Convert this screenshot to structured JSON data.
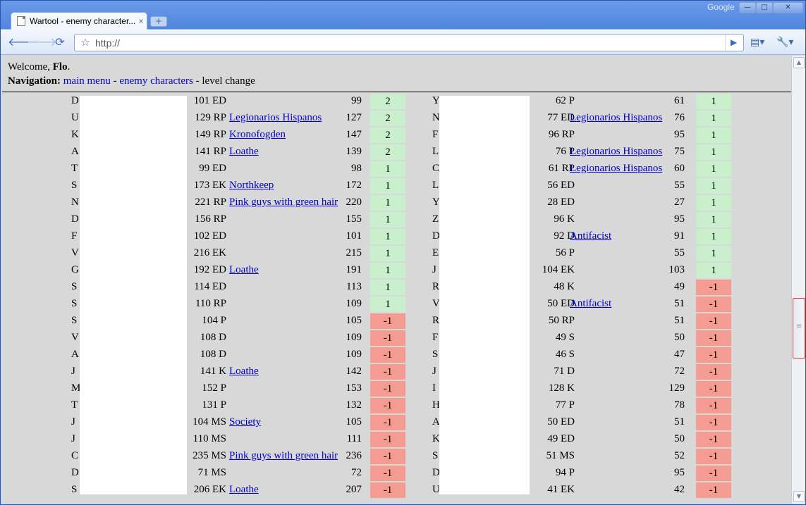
{
  "browser": {
    "tab_title": "Wartool - enemy character...",
    "tab_close": "×",
    "new_tab": "+",
    "brand": "Google",
    "address": "http://",
    "win_min": "—",
    "win_max": "□",
    "win_close": "✕"
  },
  "icons": {
    "back": "back-arrow-icon",
    "forward": "forward-arrow-icon",
    "reload": "reload-icon",
    "star": "star-icon",
    "go": "go-arrow-icon",
    "page": "page-menu-icon",
    "tools": "wrench-icon"
  },
  "header": {
    "welcome_prefix": "Welcome, ",
    "user": "Flo",
    "welcome_suffix": ".",
    "nav_label": "Navigation",
    "nav_colon": ":",
    "link_main": "main menu",
    "sep1": " - ",
    "link_enemy": "enemy characters",
    "sep2": " - ",
    "current": "level change"
  },
  "colors": {
    "positive": "#c9efcd",
    "negative": "#f49c92",
    "link": "#0000cc",
    "background": "#d8d8d8"
  },
  "left_rows": [
    {
      "name": "D",
      "lvl": "101 ED",
      "guild": "",
      "new": "99",
      "change": "2"
    },
    {
      "name": "U",
      "lvl": "129 RP",
      "guild": "Legionarios Hispanos",
      "new": "127",
      "change": "2"
    },
    {
      "name": "K",
      "lvl": "149 RP",
      "guild": "Kronofogden",
      "new": "147",
      "change": "2"
    },
    {
      "name": "A",
      "lvl": "141 RP",
      "guild": "Loathe",
      "new": "139",
      "change": "2"
    },
    {
      "name": "T",
      "lvl": "99 ED",
      "guild": "",
      "new": "98",
      "change": "1"
    },
    {
      "name": "S",
      "lvl": "173 EK",
      "guild": "Northkeep",
      "new": "172",
      "change": "1"
    },
    {
      "name": "N",
      "lvl": "221 RP",
      "guild": "Pink guys with green hair",
      "new": "220",
      "change": "1"
    },
    {
      "name": "D",
      "lvl": "156 RP",
      "guild": "",
      "new": "155",
      "change": "1"
    },
    {
      "name": "F",
      "lvl": "102 ED",
      "guild": "",
      "new": "101",
      "change": "1"
    },
    {
      "name": "V",
      "lvl": "216 EK",
      "guild": "",
      "new": "215",
      "change": "1"
    },
    {
      "name": "G",
      "lvl": "192 ED",
      "guild": "Loathe",
      "new": "191",
      "change": "1"
    },
    {
      "name": "S",
      "lvl": "114 ED",
      "guild": "",
      "new": "113",
      "change": "1"
    },
    {
      "name": "S",
      "lvl": "110 RP",
      "guild": "",
      "new": "109",
      "change": "1"
    },
    {
      "name": "S",
      "lvl": "104 P",
      "guild": "",
      "new": "105",
      "change": "-1"
    },
    {
      "name": "V",
      "lvl": "108 D",
      "guild": "",
      "new": "109",
      "change": "-1"
    },
    {
      "name": "A",
      "lvl": "108 D",
      "guild": "",
      "new": "109",
      "change": "-1"
    },
    {
      "name": "J",
      "lvl": "141 K",
      "guild": "Loathe",
      "new": "142",
      "change": "-1"
    },
    {
      "name": "M",
      "lvl": "152 P",
      "guild": "",
      "new": "153",
      "change": "-1"
    },
    {
      "name": "T",
      "lvl": "131 P",
      "guild": "",
      "new": "132",
      "change": "-1"
    },
    {
      "name": "J",
      "lvl": "104 MS",
      "guild": "Society",
      "new": "105",
      "change": "-1"
    },
    {
      "name": "J",
      "lvl": "110 MS",
      "guild": "",
      "new": "111",
      "change": "-1"
    },
    {
      "name": "C",
      "lvl": "235 MS",
      "guild": "Pink guys with green hair",
      "new": "236",
      "change": "-1"
    },
    {
      "name": "D",
      "lvl": "71 MS",
      "guild": "",
      "new": "72",
      "change": "-1"
    },
    {
      "name": "S",
      "lvl": "206 EK",
      "guild": "Loathe",
      "new": "207",
      "change": "-1"
    }
  ],
  "right_rows": [
    {
      "name": "Y",
      "lvl": "62 P",
      "guild": "",
      "new": "61",
      "change": "1"
    },
    {
      "name": "N",
      "lvl": "77 ED",
      "guild": "Legionarios Hispanos",
      "new": "76",
      "change": "1"
    },
    {
      "name": "F",
      "lvl": "96 RP",
      "guild": "",
      "new": "95",
      "change": "1"
    },
    {
      "name": "L",
      "lvl": "76 P",
      "guild": "Legionarios Hispanos",
      "new": "75",
      "change": "1"
    },
    {
      "name": "C",
      "lvl": "61 RP",
      "guild": "Legionarios Hispanos",
      "new": "60",
      "change": "1"
    },
    {
      "name": "L",
      "lvl": "56 ED",
      "guild": "",
      "new": "55",
      "change": "1"
    },
    {
      "name": "Y",
      "lvl": "28 ED",
      "guild": "",
      "new": "27",
      "change": "1"
    },
    {
      "name": "Z",
      "lvl": "96 K",
      "guild": "",
      "new": "95",
      "change": "1"
    },
    {
      "name": "D",
      "lvl": "92 D",
      "guild": "Antifacist",
      "new": "91",
      "change": "1"
    },
    {
      "name": "E",
      "lvl": "56 P",
      "guild": "",
      "new": "55",
      "change": "1"
    },
    {
      "name": "J",
      "lvl": "104 EK",
      "guild": "",
      "new": "103",
      "change": "1"
    },
    {
      "name": "R",
      "lvl": "48 K",
      "guild": "",
      "new": "49",
      "change": "-1"
    },
    {
      "name": "V",
      "lvl": "50 ED",
      "guild": "Antifacist",
      "new": "51",
      "change": "-1"
    },
    {
      "name": "R",
      "lvl": "50 RP",
      "guild": "",
      "new": "51",
      "change": "-1"
    },
    {
      "name": "F",
      "lvl": "49 S",
      "guild": "",
      "new": "50",
      "change": "-1"
    },
    {
      "name": "S",
      "lvl": "46 S",
      "guild": "",
      "new": "47",
      "change": "-1"
    },
    {
      "name": "J",
      "lvl": "71 D",
      "guild": "",
      "new": "72",
      "change": "-1"
    },
    {
      "name": "I",
      "lvl": "128 K",
      "guild": "",
      "new": "129",
      "change": "-1"
    },
    {
      "name": "H",
      "lvl": "77 P",
      "guild": "",
      "new": "78",
      "change": "-1"
    },
    {
      "name": "A",
      "lvl": "50 ED",
      "guild": "",
      "new": "51",
      "change": "-1"
    },
    {
      "name": "K",
      "lvl": "49 ED",
      "guild": "",
      "new": "50",
      "change": "-1"
    },
    {
      "name": "S",
      "lvl": "51 MS",
      "guild": "",
      "new": "52",
      "change": "-1"
    },
    {
      "name": "D",
      "lvl": "94 P",
      "guild": "",
      "new": "95",
      "change": "-1"
    },
    {
      "name": "U",
      "lvl": "41 EK",
      "guild": "",
      "new": "42",
      "change": "-1"
    }
  ]
}
